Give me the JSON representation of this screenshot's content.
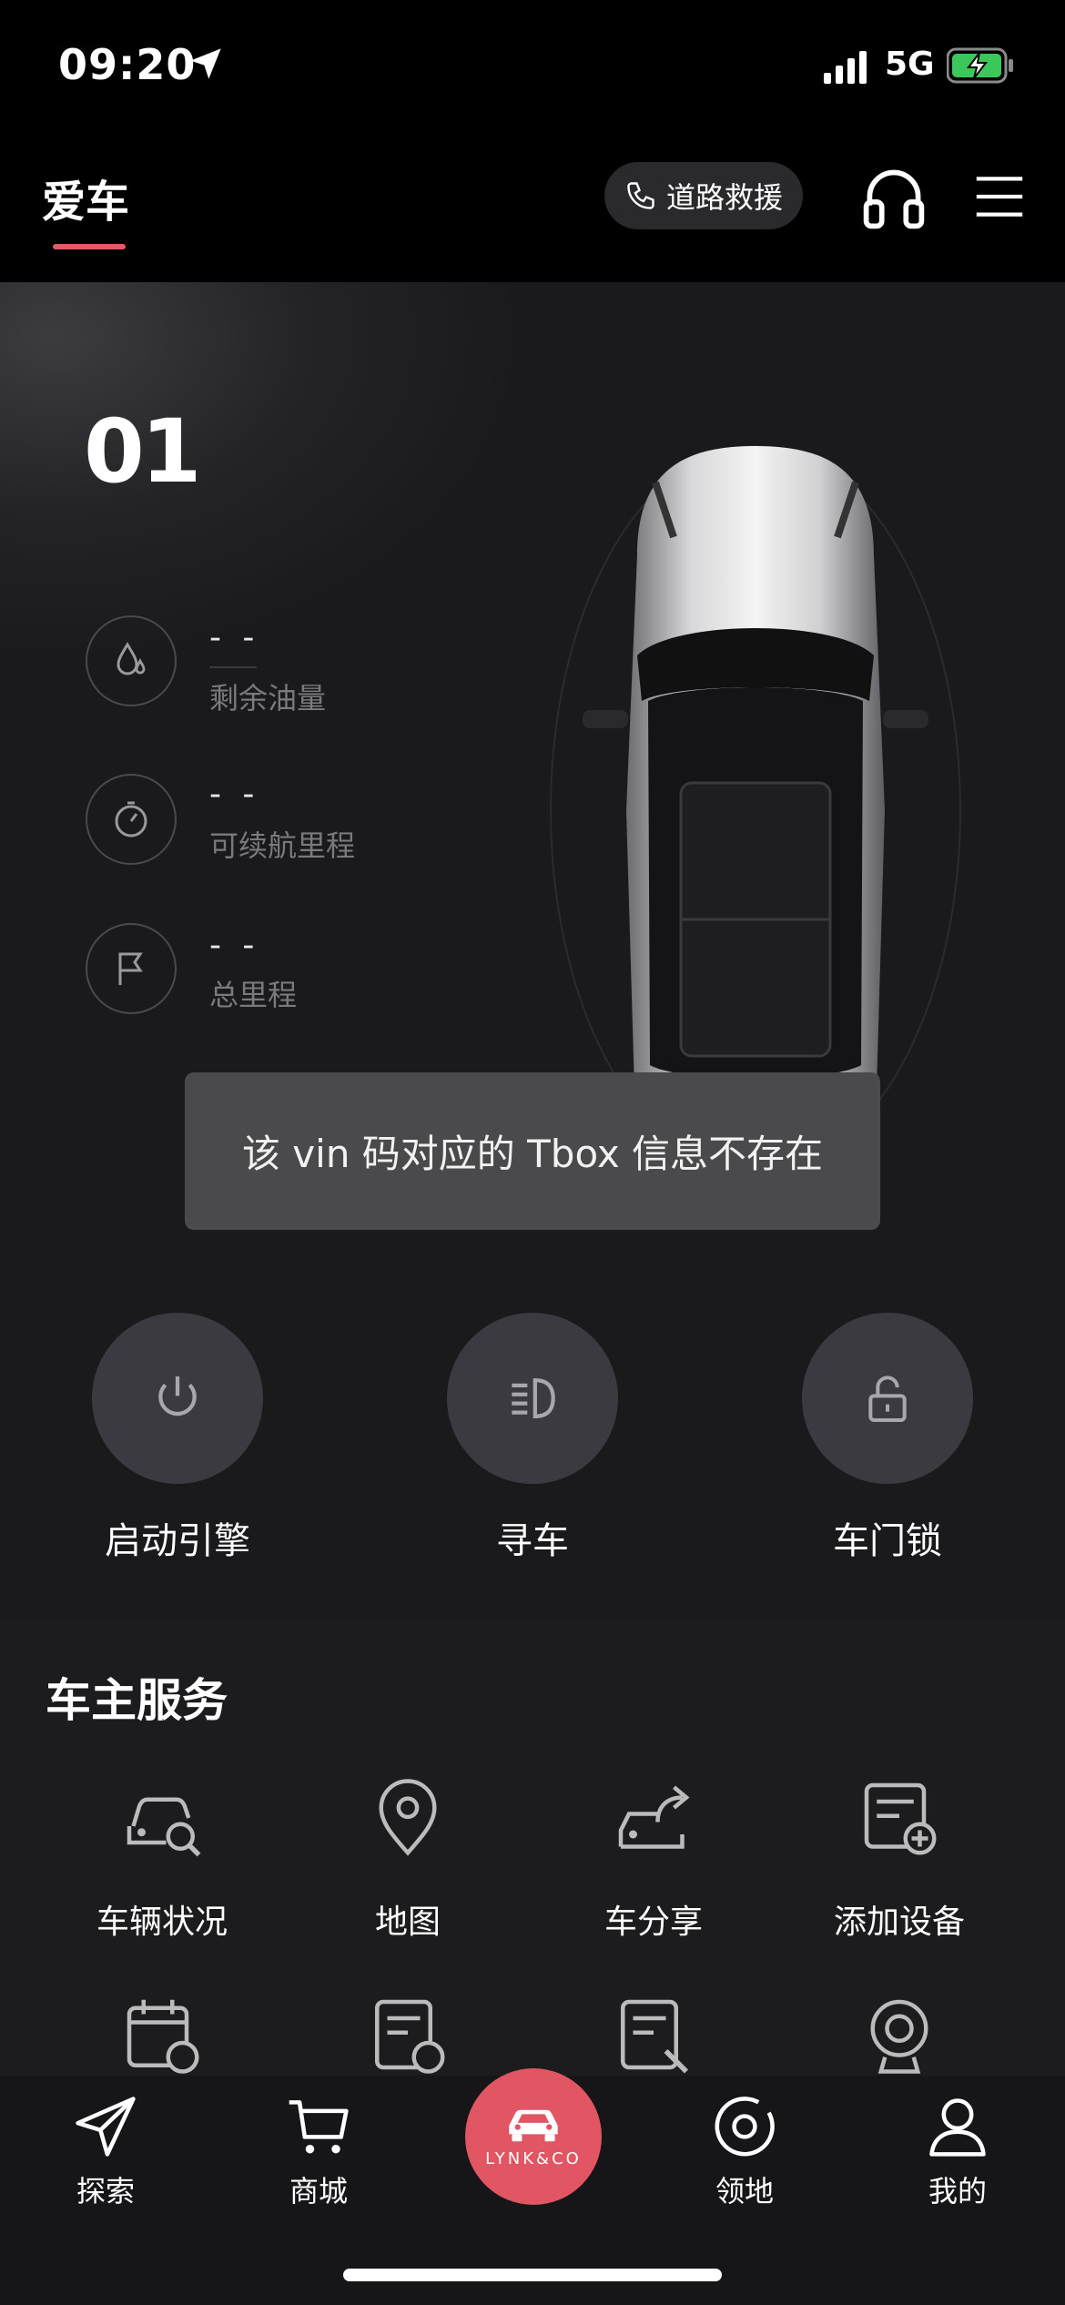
{
  "status_bar": {
    "time": "09:20",
    "network": "5G"
  },
  "header": {
    "tab_title": "爱车",
    "rescue_label": "道路救援"
  },
  "vehicle": {
    "plate": "01",
    "stats": [
      {
        "value": "- -",
        "label": "剩余油量",
        "icon": "fuel-drop-icon"
      },
      {
        "value": "- -",
        "label": "可续航里程",
        "icon": "speedometer-icon"
      },
      {
        "value": "- -",
        "label": "总里程",
        "icon": "flag-icon"
      }
    ]
  },
  "toast": "该 vin 码对应的 Tbox 信息不存在",
  "controls": [
    {
      "label": "启动引擎",
      "icon": "power-icon"
    },
    {
      "label": "寻车",
      "icon": "headlight-icon"
    },
    {
      "label": "车门锁",
      "icon": "lock-open-icon"
    }
  ],
  "services": {
    "title": "车主服务",
    "items": [
      {
        "label": "车辆状况",
        "icon": "car-search-icon"
      },
      {
        "label": "地图",
        "icon": "map-pin-icon"
      },
      {
        "label": "车分享",
        "icon": "car-share-icon"
      },
      {
        "label": "添加设备",
        "icon": "add-device-icon"
      }
    ],
    "row2_icons": [
      "calendar-clock-icon",
      "doc-refresh-icon",
      "doc-wrench-icon",
      "camera-icon"
    ]
  },
  "bottom_nav": {
    "items": [
      {
        "label": "探索",
        "icon": "send-icon"
      },
      {
        "label": "商城",
        "icon": "cart-icon"
      },
      {
        "label": "领地",
        "icon": "target-icon"
      },
      {
        "label": "我的",
        "icon": "user-icon"
      }
    ],
    "center_brand": "LYNK&CO"
  },
  "colors": {
    "accent": "#e25664",
    "background": "#0c0c0d"
  }
}
